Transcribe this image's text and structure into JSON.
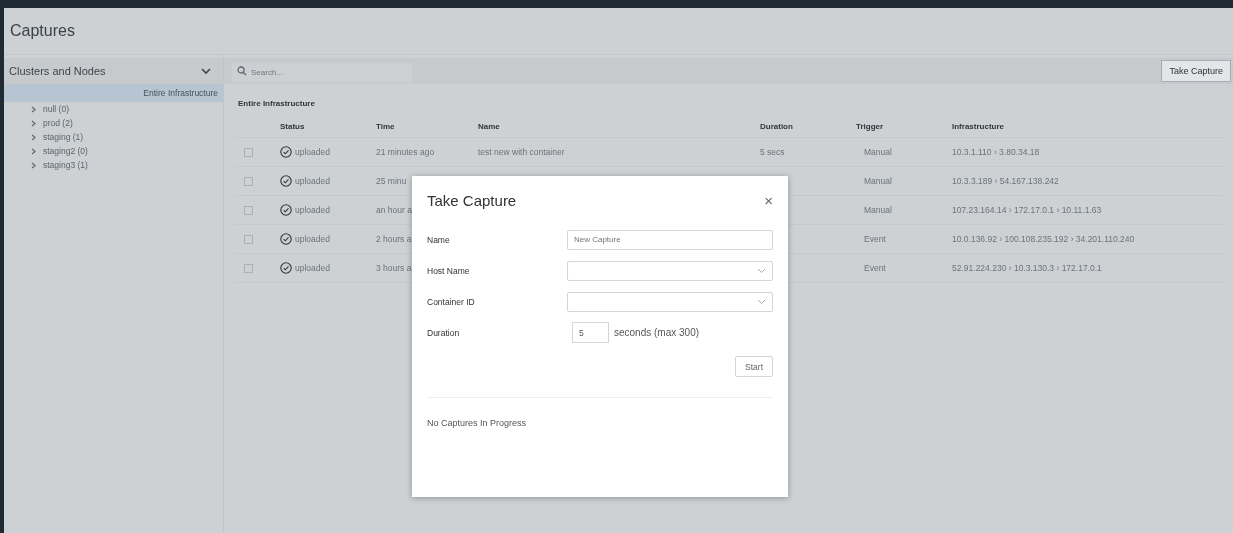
{
  "header": {
    "title": "Captures"
  },
  "sidebar": {
    "dropdown": "Clusters and Nodes",
    "tree": [
      {
        "label": "Entire Infrastructure",
        "selected": true,
        "children": [
          {
            "label": "null (0)",
            "selected": false,
            "expanded": false
          },
          {
            "label": "prod (2)",
            "selected": false,
            "expanded": false
          },
          {
            "label": "staging (1)",
            "selected": false,
            "expanded": false
          },
          {
            "label": "staging2 (0)",
            "selected": false,
            "expanded": false
          },
          {
            "label": "staging3 (1)",
            "selected": false,
            "expanded": false
          }
        ]
      }
    ]
  },
  "toolbar": {
    "search_placeholder": "Search...",
    "button": "Take Capture"
  },
  "table": {
    "title": "Entire Infrastructure",
    "columns": [
      "Status",
      "Time",
      "Name",
      "Duration",
      "Trigger",
      "Infrastructure"
    ],
    "rows": [
      {
        "checked": false,
        "status": "uploaded",
        "time": "21 minutes ago",
        "name": "test new with container",
        "duration": "5 secs",
        "trigger": "Manual",
        "infrastructure": "10.3.1.110 › 3.80.34.18"
      },
      {
        "checked": false,
        "status": "uploaded",
        "time": "25 minu",
        "trigger": "Manual",
        "infrastructure": "10.3.3.189 › 54.167.138.242"
      },
      {
        "checked": false,
        "status": "uploaded",
        "time": "an hour a",
        "trigger": "Manual",
        "infrastructure": "107.23.164.14 › 172.17.0.1 › 10.11.1.63"
      },
      {
        "checked": false,
        "status": "uploaded",
        "time": "2 hours a",
        "trigger": "Event",
        "infrastructure": "10.0.136.92 › 100.108.235.192 › 34.201.110.240"
      },
      {
        "checked": false,
        "status": "uploaded",
        "time": "3 hours a",
        "trigger": "Event",
        "infrastructure": "52.91.224.230 › 10.3.130.3 › 172.17.0.1"
      }
    ]
  },
  "dialog": {
    "title": "Take Capture",
    "close": "×",
    "fields": [
      {
        "kind": "text",
        "label": "Name",
        "placeholder": "New Capture"
      },
      {
        "kind": "select",
        "label": "Host Name"
      },
      {
        "kind": "select",
        "label": "Container ID"
      },
      {
        "kind": "number",
        "label": "Duration",
        "value": "5",
        "suffix": "seconds (max 300)"
      }
    ],
    "button": "Start",
    "status": "No Captures In Progress"
  }
}
